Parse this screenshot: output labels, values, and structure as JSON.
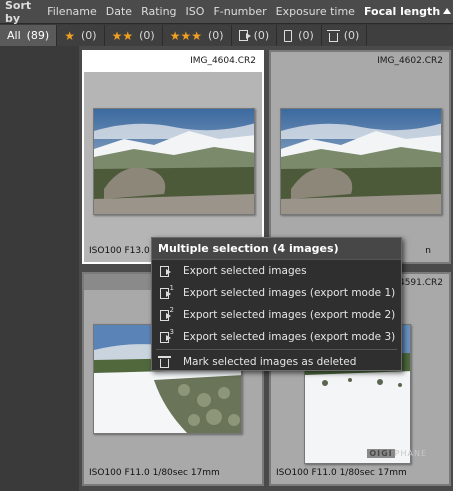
{
  "sortbar": {
    "title": "Sort by",
    "options": [
      "Filename",
      "Date",
      "Rating",
      "ISO",
      "F-number",
      "Exposure time",
      "Focal length"
    ],
    "active_option": "Focal length"
  },
  "filterbar": {
    "tabs": [
      {
        "label": "All",
        "count": "(89)"
      },
      {
        "icon": "star-1",
        "count": "(0)"
      },
      {
        "icon": "star-2",
        "count": "(0)"
      },
      {
        "icon": "star-3",
        "count": "(0)"
      },
      {
        "icon": "export-icon",
        "count": "(0)"
      },
      {
        "icon": "phone-icon",
        "count": "(0)"
      },
      {
        "icon": "trash-icon",
        "count": "(0)"
      }
    ],
    "star_color": "#f0a020"
  },
  "thumbnails": [
    {
      "filename": "IMG_4604.CR2",
      "meta": "ISO100  F13.0",
      "selected": true
    },
    {
      "filename": "IMG_4602.CR2",
      "meta": "n",
      "selected": false
    },
    {
      "filename": "",
      "meta": "ISO100  F11.0  1/80sec  17mm",
      "selected": false
    },
    {
      "filename": "4591.CR2",
      "meta": "ISO100  F11.0  1/80sec  17mm",
      "selected": false
    }
  ],
  "context_menu": {
    "title": "Multiple selection (4 images)",
    "items": [
      {
        "label": "Export selected images",
        "icon": "export-icon",
        "mode": ""
      },
      {
        "label": "Export selected images (export mode 1)",
        "icon": "export-icon",
        "mode": "1"
      },
      {
        "label": "Export selected images (export mode 2)",
        "icon": "export-icon",
        "mode": "2"
      },
      {
        "label": "Export selected images (export mode 3)",
        "icon": "export-icon",
        "mode": "3"
      },
      {
        "label": "Mark selected images as deleted",
        "icon": "trash-icon",
        "mode": ""
      }
    ]
  },
  "watermark": {
    "part1": "OIGI",
    "part2": "PHANE"
  }
}
